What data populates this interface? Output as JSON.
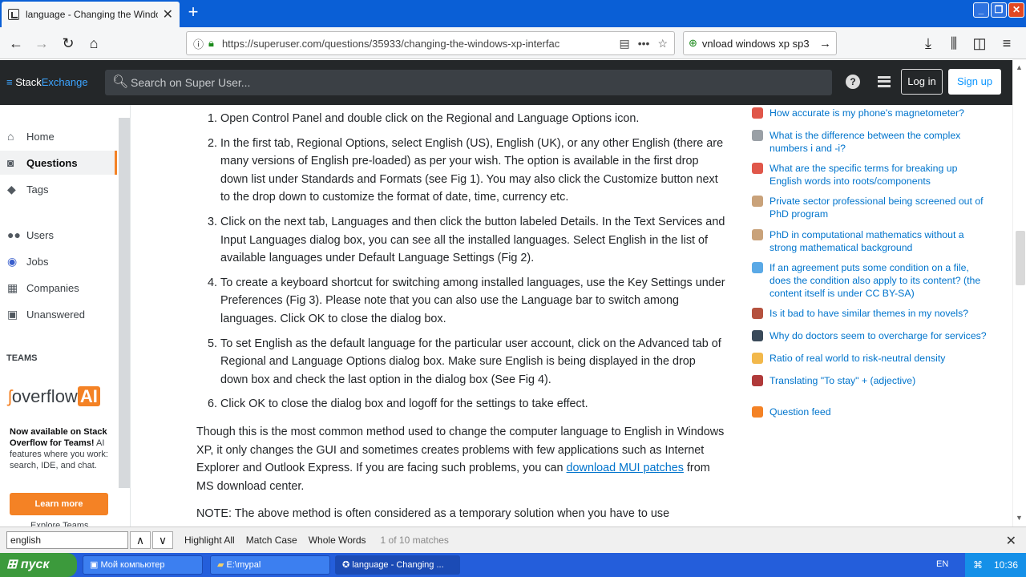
{
  "browser": {
    "tab_title": "language - Changing the Windows XP interface language",
    "url": "https://superuser.com/questions/35933/changing-the-windows-xp-interfac",
    "search_query": "vnload windows xp sp3"
  },
  "header": {
    "logo_stack": "Stack",
    "logo_exchange": "Exchange",
    "search_placeholder": "Search on Super User...",
    "login": "Log in",
    "signup": "Sign up"
  },
  "leftnav": {
    "items": [
      "Home",
      "Questions",
      "Tags",
      "Users",
      "Jobs",
      "Companies",
      "Unanswered"
    ],
    "teams_label": "TEAMS",
    "overflow": "overflow",
    "ai": "AI",
    "promo_bold": "Now available on Stack Overflow for Teams!",
    "promo_rest": " AI features where you work: search, IDE, and chat.",
    "learn_more": "Learn more",
    "explore": "Explore Teams"
  },
  "answer": {
    "steps": [
      "Open Control Panel and double click on the Regional and Language Options icon.",
      "In the first tab, Regional Options, select English (US), English (UK), or any other English (there are many versions of English pre-loaded) as per your wish. The option is available in the first drop down list under Standards and Formats (see Fig 1). You may also click the Customize button next to the drop down to customize the format of date, time, currency etc.",
      "Click on the next tab, Languages and then click the button labeled Details. In the Text Services and Input Languages dialog box, you can see all the installed languages. Select English in the list of available languages under Default Language Settings (Fig 2).",
      "To create a keyboard shortcut for switching among installed languages, use the Key Settings under Preferences (Fig 3). Please note that you can also use the Language bar to switch among languages. Click OK to close the dialog box.",
      "To set English as the default language for the particular user account, click on the Advanced tab of Regional and Language Options dialog box. Make sure English is being displayed in the drop down box and check the last option in the dialog box (See Fig 4).",
      "Click OK to close the dialog box and logoff for the settings to take effect."
    ],
    "para1_before": "Though this is the most common method used to change the computer language to English in Windows XP, it only changes the GUI and sometimes creates problems with few applications such as Internet Explorer and Outlook Express. If you are facing such problems, you can ",
    "para1_link": "download MUI patches",
    "para1_after": " from MS download center.",
    "para2": "NOTE: The above method is often considered as a temporary solution when you have to use"
  },
  "hot_questions": [
    {
      "title": "How accurate is my phone's magnetometer?",
      "color": "#e0574a"
    },
    {
      "title": "What is the difference between the complex numbers i and -i?",
      "color": "#9aa0a6"
    },
    {
      "title": "What are the specific terms for breaking up English words into roots/components",
      "color": "#e0574a"
    },
    {
      "title": "Private sector professional being screened out of PhD program",
      "color": "#c9a27a"
    },
    {
      "title": "PhD in computational mathematics without a strong mathematical background",
      "color": "#c9a27a"
    },
    {
      "title": "If an agreement puts some condition on a file, does the condition also apply to its content? (the content itself is under CC BY-SA)",
      "color": "#5aa9e6"
    },
    {
      "title": "Is it bad to have similar themes in my novels?",
      "color": "#b5523f"
    },
    {
      "title": "Why do doctors seem to overcharge for services?",
      "color": "#3a4a5a"
    },
    {
      "title": "Ratio of real world to risk-neutral density",
      "color": "#f2b84b"
    },
    {
      "title": "Translating \"To stay\" + (adjective)",
      "color": "#b03a3a"
    }
  ],
  "question_feed": "Question feed",
  "findbar": {
    "query": "english",
    "highlight_all": "Highlight All",
    "match_case": "Match Case",
    "whole_words": "Whole Words",
    "count": "1 of 10 matches"
  },
  "taskbar": {
    "start": "пуск",
    "items": [
      "Мой компьютер",
      "E:\\mypal",
      "language - Changing ..."
    ],
    "lang": "EN",
    "time": "10:36"
  }
}
